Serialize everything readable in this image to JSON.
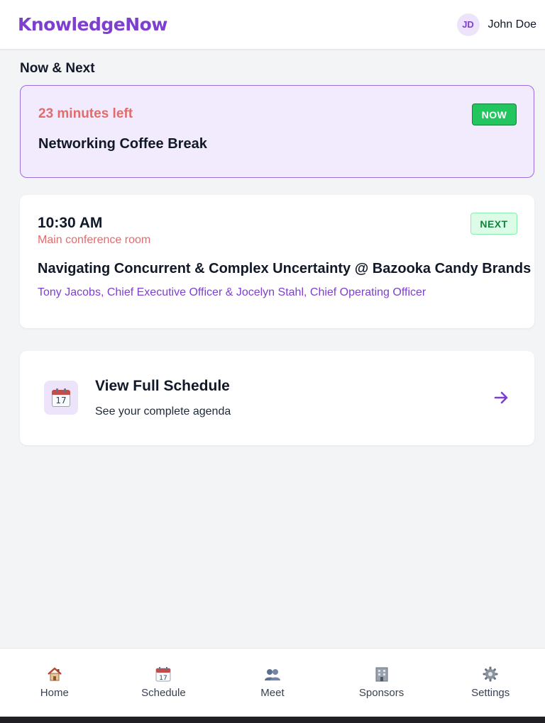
{
  "header": {
    "brand": "KnowledgeNow",
    "user_initials": "JD",
    "user_name": "John Doe"
  },
  "section": {
    "title": "Now & Next"
  },
  "now_card": {
    "time_left": "23 minutes left",
    "badge": "NOW",
    "title": "Networking Coffee Break"
  },
  "next_card": {
    "time": "10:30 AM",
    "room": "Main conference room",
    "badge": "NEXT",
    "title": "Navigating Concurrent & Complex Uncertainty @ Bazooka Candy Brands",
    "speakers": "Tony Jacobs, Chief Executive Officer & Jocelyn Stahl, Chief Operating Officer"
  },
  "schedule_card": {
    "icon": "calendar-icon",
    "calendar_day": "17",
    "title": "View Full Schedule",
    "subtitle": "See your complete agenda"
  },
  "nav": {
    "items": [
      {
        "label": "Home",
        "icon": "home-icon"
      },
      {
        "label": "Schedule",
        "icon": "calendar-icon"
      },
      {
        "label": "Meet",
        "icon": "people-icon"
      },
      {
        "label": "Sponsors",
        "icon": "building-icon"
      },
      {
        "label": "Settings",
        "icon": "gear-icon"
      }
    ]
  },
  "colors": {
    "brand": "#7e3fcf",
    "accent_red": "#e06c6c",
    "now_badge": "#22c55e",
    "next_badge_bg": "#dcfce7",
    "now_card_bg": "#f1ebfd",
    "page_bg": "#f3f4f6"
  }
}
